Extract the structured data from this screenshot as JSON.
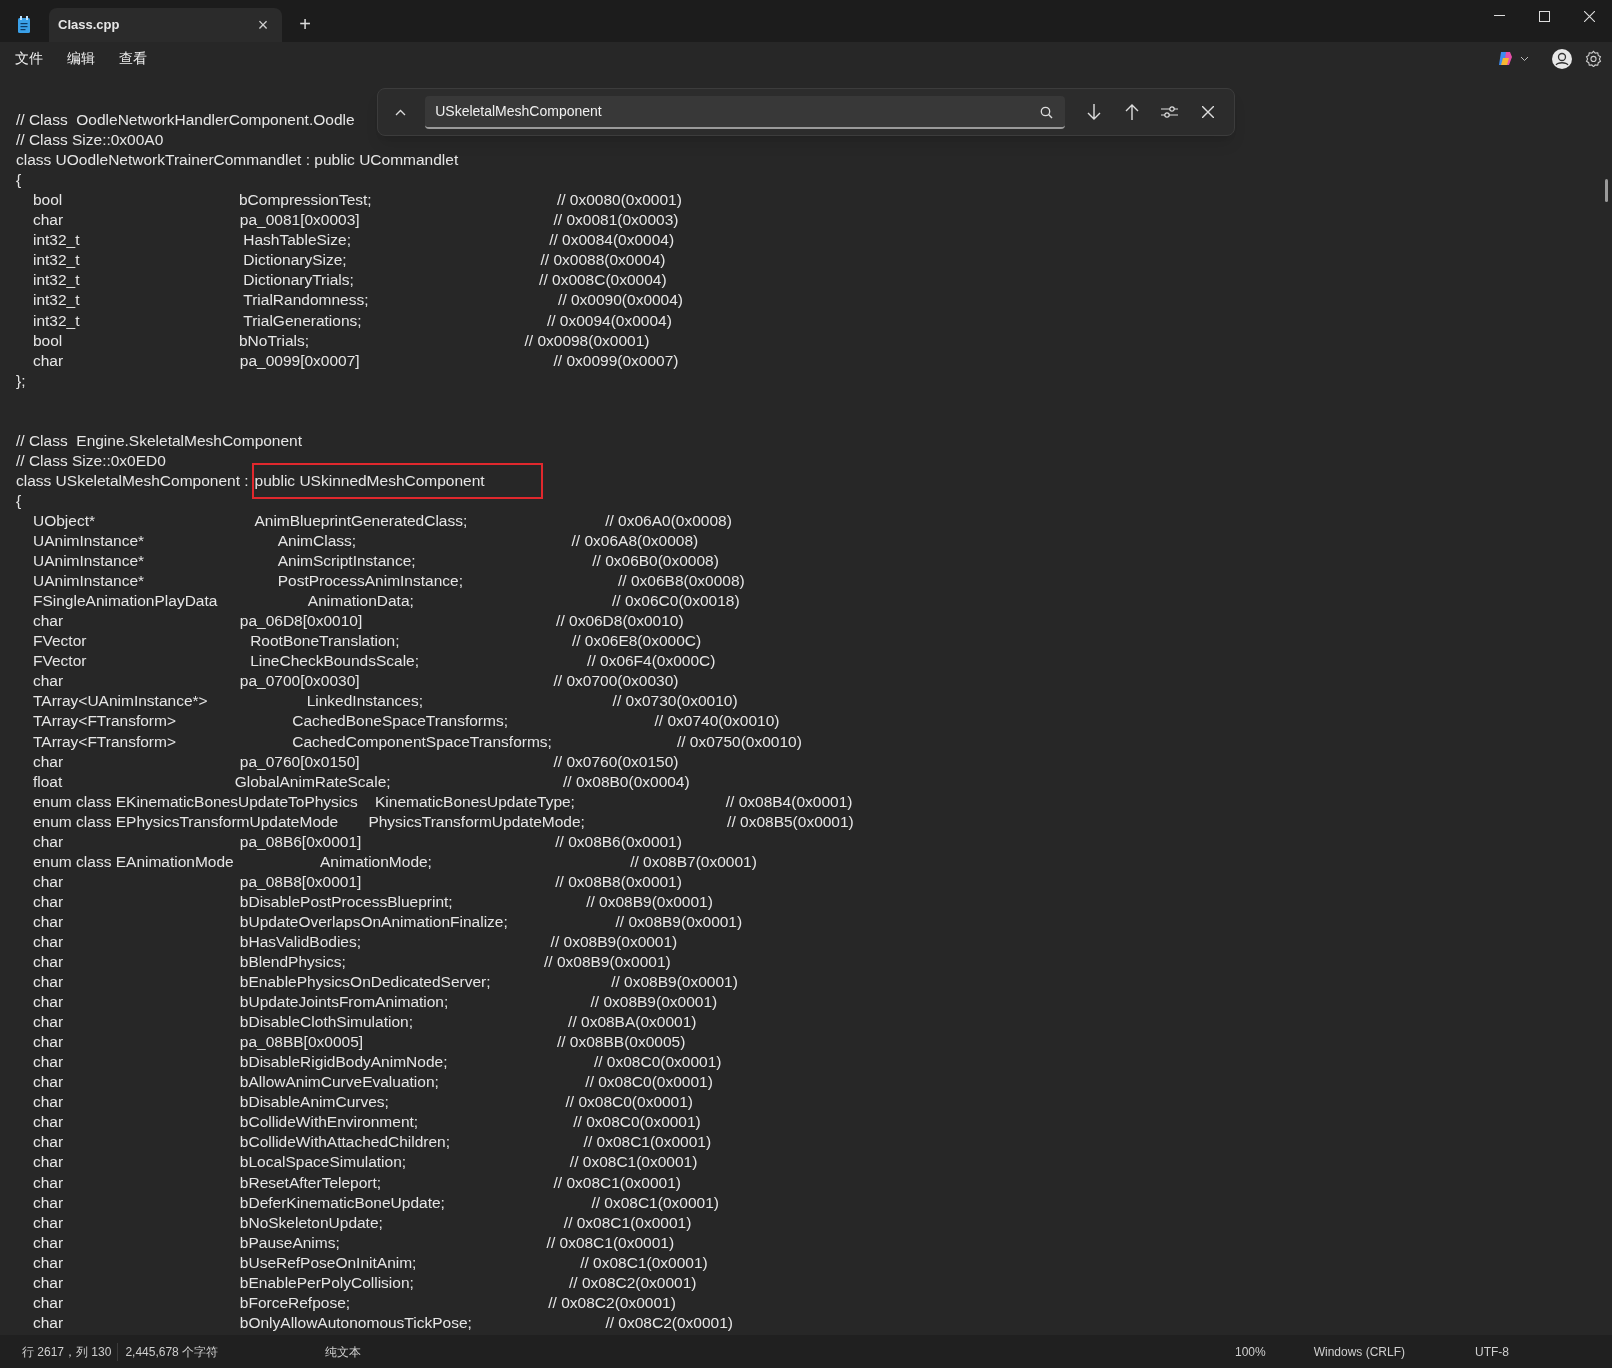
{
  "window": {
    "tab": {
      "title": "Class.cpp",
      "close": "×",
      "selected": true
    },
    "new_tab": "+"
  },
  "menu": [
    "文件",
    "编辑",
    "查看"
  ],
  "find_bar": {
    "value": "USkeletalMeshComponent"
  },
  "lines": [
    {
      "kind": "blank"
    },
    {
      "kind": "text",
      "text": "// Class  OodleNetworkHandlerComponent.Oodle"
    },
    {
      "kind": "text",
      "text": "// Class Size::0x00A0"
    },
    {
      "kind": "text",
      "text": "class UOodleNetworkTrainerCommandlet : public UCommandlet"
    },
    {
      "kind": "text",
      "text": "{"
    },
    {
      "kind": "field",
      "type": "bool",
      "name": "bCompressionTest;",
      "comment": "// 0x0080(0x0001)"
    },
    {
      "kind": "field",
      "type": "char",
      "name": "pa_0081[0x0003]",
      "comment": "// 0x0081(0x0003)"
    },
    {
      "kind": "field",
      "type": "int32_t",
      "name": "HashTableSize;",
      "comment": "// 0x0084(0x0004)"
    },
    {
      "kind": "field",
      "type": "int32_t",
      "name": "DictionarySize;",
      "comment": "// 0x0088(0x0004)"
    },
    {
      "kind": "field",
      "type": "int32_t",
      "name": "DictionaryTrials;",
      "comment": "// 0x008C(0x0004)"
    },
    {
      "kind": "field",
      "type": "int32_t",
      "name": "TrialRandomness;",
      "comment": "// 0x0090(0x0004)"
    },
    {
      "kind": "field",
      "type": "int32_t",
      "name": "TrialGenerations;",
      "comment": "// 0x0094(0x0004)"
    },
    {
      "kind": "field",
      "type": "bool",
      "name": "bNoTrials;",
      "comment": "// 0x0098(0x0001)"
    },
    {
      "kind": "field",
      "type": "char",
      "name": "pa_0099[0x0007]",
      "comment": "// 0x0099(0x0007)"
    },
    {
      "kind": "text",
      "text": "};"
    },
    {
      "kind": "blank"
    },
    {
      "kind": "blank"
    },
    {
      "kind": "text",
      "text": "// Class  Engine.SkeletalMeshComponent"
    },
    {
      "kind": "text",
      "text": "// Class Size::0x0ED0"
    },
    {
      "kind": "text",
      "text": "class USkeletalMeshComponent :",
      "highlight": "public USkinnedMeshComponent"
    },
    {
      "kind": "text",
      "text": "{"
    },
    {
      "kind": "field",
      "type": "UObject*",
      "name": "AnimBlueprintGeneratedClass;",
      "comment": "// 0x06A0(0x0008)"
    },
    {
      "kind": "field",
      "type": "UAnimInstance*",
      "name": "AnimClass;",
      "comment": "// 0x06A8(0x0008)"
    },
    {
      "kind": "field",
      "type": "UAnimInstance*",
      "name": "AnimScriptInstance;",
      "comment": "// 0x06B0(0x0008)"
    },
    {
      "kind": "field",
      "type": "UAnimInstance*",
      "name": "PostProcessAnimInstance;",
      "comment": "// 0x06B8(0x0008)"
    },
    {
      "kind": "field",
      "type": "FSingleAnimationPlayData",
      "name": "AnimationData;",
      "comment": "// 0x06C0(0x0018)"
    },
    {
      "kind": "field",
      "type": "char",
      "name": "pa_06D8[0x0010]",
      "comment": "// 0x06D8(0x0010)"
    },
    {
      "kind": "field",
      "type": "FVector",
      "name": "RootBoneTranslation;",
      "comment": "// 0x06E8(0x000C)"
    },
    {
      "kind": "field",
      "type": "FVector",
      "name": "LineCheckBoundsScale;",
      "comment": "// 0x06F4(0x000C)"
    },
    {
      "kind": "field",
      "type": "char",
      "name": "pa_0700[0x0030]",
      "comment": "// 0x0700(0x0030)"
    },
    {
      "kind": "field",
      "type": "TArray<UAnimInstance*>",
      "name": "LinkedInstances;",
      "comment": "// 0x0730(0x0010)"
    },
    {
      "kind": "field",
      "type": "TArray<FTransform>",
      "name": "CachedBoneSpaceTransforms;",
      "comment": "// 0x0740(0x0010)"
    },
    {
      "kind": "field",
      "type": "TArray<FTransform>",
      "name": "CachedComponentSpaceTransforms;",
      "comment": "// 0x0750(0x0010)"
    },
    {
      "kind": "field",
      "type": "char",
      "name": "pa_0760[0x0150]",
      "comment": "// 0x0760(0x0150)"
    },
    {
      "kind": "field",
      "type": "float",
      "name": "GlobalAnimRateScale;",
      "comment": "// 0x08B0(0x0004)"
    },
    {
      "kind": "field",
      "type": "enum class EKinematicBonesUpdateToPhysics",
      "name": "KinematicBonesUpdateType;",
      "comment": "// 0x08B4(0x0001)"
    },
    {
      "kind": "field",
      "type": "enum class EPhysicsTransformUpdateMode",
      "name": "PhysicsTransformUpdateMode;",
      "comment": "// 0x08B5(0x0001)"
    },
    {
      "kind": "field",
      "type": "char",
      "name": "pa_08B6[0x0001]",
      "comment": "// 0x08B6(0x0001)"
    },
    {
      "kind": "field",
      "type": "enum class EAnimationMode",
      "name": "AnimationMode;",
      "comment": "// 0x08B7(0x0001)"
    },
    {
      "kind": "field",
      "type": "char",
      "name": "pa_08B8[0x0001]",
      "comment": "// 0x08B8(0x0001)"
    },
    {
      "kind": "field",
      "type": "char",
      "name": "bDisablePostProcessBlueprint;",
      "comment": "// 0x08B9(0x0001)"
    },
    {
      "kind": "field",
      "type": "char",
      "name": "bUpdateOverlapsOnAnimationFinalize;",
      "comment": "// 0x08B9(0x0001)"
    },
    {
      "kind": "field",
      "type": "char",
      "name": "bHasValidBodies;",
      "comment": "// 0x08B9(0x0001)"
    },
    {
      "kind": "field",
      "type": "char",
      "name": "bBlendPhysics;",
      "comment": "// 0x08B9(0x0001)"
    },
    {
      "kind": "field",
      "type": "char",
      "name": "bEnablePhysicsOnDedicatedServer;",
      "comment": "// 0x08B9(0x0001)"
    },
    {
      "kind": "field",
      "type": "char",
      "name": "bUpdateJointsFromAnimation;",
      "comment": "// 0x08B9(0x0001)"
    },
    {
      "kind": "field",
      "type": "char",
      "name": "bDisableClothSimulation;",
      "comment": "// 0x08BA(0x0001)"
    },
    {
      "kind": "field",
      "type": "char",
      "name": "pa_08BB[0x0005]",
      "comment": "// 0x08BB(0x0005)"
    },
    {
      "kind": "field",
      "type": "char",
      "name": "bDisableRigidBodyAnimNode;",
      "comment": "// 0x08C0(0x0001)"
    },
    {
      "kind": "field",
      "type": "char",
      "name": "bAllowAnimCurveEvaluation;",
      "comment": "// 0x08C0(0x0001)"
    },
    {
      "kind": "field",
      "type": "char",
      "name": "bDisableAnimCurves;",
      "comment": "// 0x08C0(0x0001)"
    },
    {
      "kind": "field",
      "type": "char",
      "name": "bCollideWithEnvironment;",
      "comment": "// 0x08C0(0x0001)"
    },
    {
      "kind": "field",
      "type": "char",
      "name": "bCollideWithAttachedChildren;",
      "comment": "// 0x08C1(0x0001)"
    },
    {
      "kind": "field",
      "type": "char",
      "name": "bLocalSpaceSimulation;",
      "comment": "// 0x08C1(0x0001)"
    },
    {
      "kind": "field",
      "type": "char",
      "name": "bResetAfterTeleport;",
      "comment": "// 0x08C1(0x0001)"
    },
    {
      "kind": "field",
      "type": "char",
      "name": "bDeferKinematicBoneUpdate;",
      "comment": "// 0x08C1(0x0001)"
    },
    {
      "kind": "field",
      "type": "char",
      "name": "bNoSkeletonUpdate;",
      "comment": "// 0x08C1(0x0001)"
    },
    {
      "kind": "field",
      "type": "char",
      "name": "bPauseAnims;",
      "comment": "// 0x08C1(0x0001)"
    },
    {
      "kind": "field",
      "type": "char",
      "name": "bUseRefPoseOnInitAnim;",
      "comment": "// 0x08C1(0x0001)"
    },
    {
      "kind": "field",
      "type": "char",
      "name": "bEnablePerPolyCollision;",
      "comment": "// 0x08C2(0x0001)"
    },
    {
      "kind": "field",
      "type": "char",
      "name": "bForceRefpose;",
      "comment": "// 0x08C2(0x0001)"
    },
    {
      "kind": "field",
      "type": "char",
      "name": "bOnlyAllowAutonomousTickPose;",
      "comment": "// 0x08C2(0x0001)"
    }
  ],
  "status_bar": {
    "position": "行 2617，列 130",
    "characters": "2,445,678 个字符",
    "format": "纯文本",
    "zoom": "100%",
    "line_ending": "Windows (CRLF)",
    "encoding": "UTF-8"
  }
}
